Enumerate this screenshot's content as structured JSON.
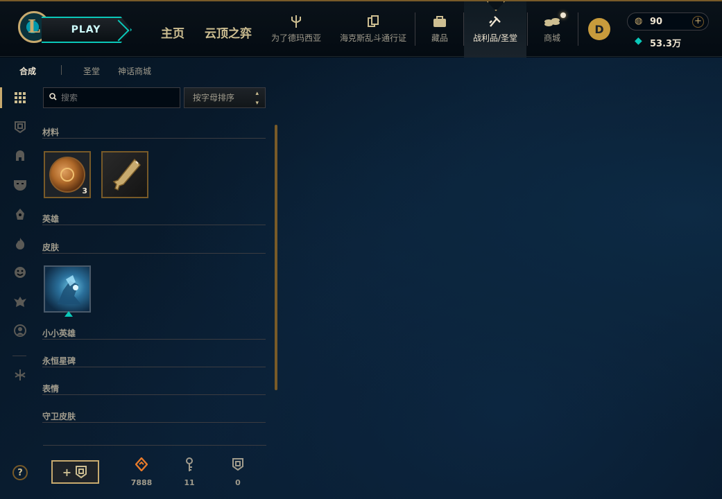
{
  "topbar": {
    "logo_letter": "L",
    "play_label": "PLAY",
    "nav_main": [
      "主页",
      "云顶之弈"
    ],
    "nav_icons": [
      {
        "label": "为了德玛西亚",
        "icon": "trident-icon"
      },
      {
        "label": "海克斯乱斗通行证",
        "icon": "cards-icon"
      },
      {
        "label": "藏品",
        "icon": "bag-icon"
      },
      {
        "label": "战利品/圣堂",
        "icon": "loot-icon"
      },
      {
        "label": "商城",
        "icon": "coins-icon"
      }
    ],
    "active_nav": "战利品/圣堂",
    "profile_badge": "D",
    "rp_value": "90",
    "rp_plus": "+",
    "be_value": "53.3万"
  },
  "subtabs": {
    "active": "合成",
    "items": [
      "合成",
      "圣堂",
      "神话商城"
    ]
  },
  "search": {
    "placeholder": "搜索"
  },
  "sort": {
    "label": "按字母排序",
    "arrows": "⌃⌄"
  },
  "sections": [
    {
      "title": "材料"
    },
    {
      "title": "英雄"
    },
    {
      "title": "皮肤"
    },
    {
      "title": "小小英雄"
    },
    {
      "title": "永恒星碑"
    },
    {
      "title": "表情"
    },
    {
      "title": "守卫皮肤"
    }
  ],
  "materials": [
    {
      "name": "token",
      "count": "3"
    },
    {
      "name": "key",
      "count": ""
    }
  ],
  "bottom": {
    "help": "?",
    "add_chest": "+",
    "currencies": [
      {
        "icon": "orange-essence-icon",
        "value": "7888"
      },
      {
        "icon": "key-fragment-icon",
        "value": "11"
      },
      {
        "icon": "chest-icon",
        "value": "0"
      }
    ]
  },
  "colors": {
    "gold": "#c8aa6e",
    "teal": "#0ac8b9",
    "background": "#010a13"
  }
}
